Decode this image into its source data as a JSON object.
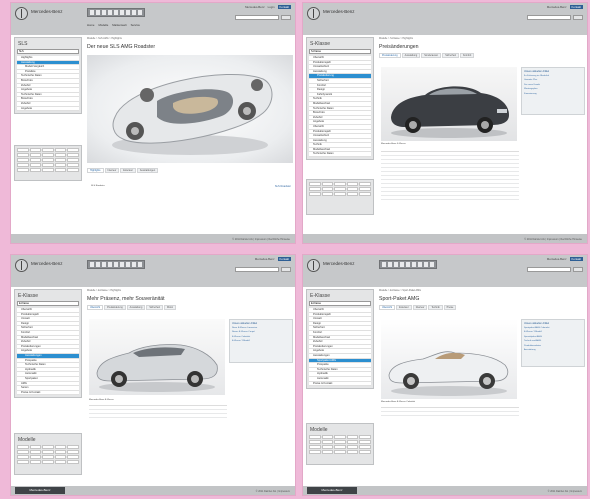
{
  "header": {
    "brand": "Mercedes-Benz",
    "top_links": [
      "Mercedes-Benz",
      "Login",
      "Kontakt"
    ],
    "top_button": "Kontakt",
    "nav": [
      "Home",
      "Modelle",
      "Markenwelt",
      "Service",
      "Über uns",
      "Karriere"
    ]
  },
  "shots": [
    {
      "section_title": "SLS",
      "select_value": "SLS",
      "crumb": "Modelle > SLS AMG > Highlights",
      "title": "Der neue SLS AMG Roadster",
      "menu": [
        "Highlights",
        "Ausstattung",
        "Modell-Vergleich",
        "Preisliste",
        "Technische Daten",
        "Broschüre",
        "Zubehör",
        "Angebote"
      ],
      "active": 1,
      "tabs": [
        "Highlights",
        "Interieur",
        "Exterieur",
        "Ausstattungen"
      ],
      "bottom_left": "SLS Roadster",
      "bottom_right": "SLS Roadster",
      "foot": [
        "© 2011 Daimler AG",
        "Impressum",
        "Rechtliche Hinweise",
        "Cookies"
      ]
    },
    {
      "section_title": "S-Klasse",
      "select_value": "S-Klasse",
      "crumb": "Modelle > S-Klasse > Highlights",
      "title": "Preisänderungen",
      "menu": [
        "Übersicht",
        "Produktionsjahr",
        "Umweltschutz",
        "Ausstattung",
        "Preisänderung",
        "Sicherheit",
        "Komfort",
        "Design",
        "Fahrdynamik",
        "Technik",
        "Modellwechsel",
        "Technische Daten",
        "Broschüre",
        "Zubehör",
        "Angebote"
      ],
      "active": 4,
      "tabs": [
        "Preisänderung",
        "Ausstattung",
        "Sonderausst.",
        "Sicherheit",
        "Komfort"
      ],
      "aside_title": "Unsere aktuellen Artikel",
      "aside_links": [
        "Ihr Fahrzeug im Überblick",
        "Garantie Plus",
        "Der neue Kombi",
        "Wartungsplan",
        "Finanzierung",
        "Versicherung"
      ],
      "caption": "Mercedes-Benz S-Klasse",
      "foot": [
        "© 2011 Daimler AG",
        "Impressum",
        "Rechtliche Hinweise",
        "Cookies"
      ]
    },
    {
      "section_title": "E-Klasse",
      "select_value": "E-Klasse",
      "crumb": "Modelle > E-Klasse > Highlights",
      "title": "Mehr Präsenz, mehr Souveränität",
      "menu": [
        "Übersicht",
        "Produktionsjahr",
        "Umwelt",
        "Design",
        "Sicherheit",
        "Komfort",
        "Modellwechsel",
        "Zubehör",
        "Preisänderungen",
        "Angebote",
        "Ausstattungen",
        "Prospekte",
        "Technische Daten",
        "Hydraulik",
        "Automatik",
        "Sportpaket",
        "AMG",
        "Serien",
        "Preise & Kontakt"
      ],
      "active": 10,
      "tabs": [
        "Übersicht",
        "Preisänderung",
        "Ausstattung",
        "Sicherheit",
        "Motor"
      ],
      "aside_title": "Unsere aktuellen Artikel",
      "aside_links": [
        "Neue E-Klasse Limousine",
        "Neues E-Klasse Coupé",
        "E-Klasse Cabriolet",
        "E-Klasse T-Modell"
      ],
      "caption": "Mercedes-Benz E-Klasse",
      "section2": "Modelle",
      "foot": [
        "© 2011 Daimler AG",
        "Impressum",
        "Rechtliche Hinweise",
        "Cookies"
      ]
    },
    {
      "section_title": "E-Klasse",
      "select_value": "E-Klasse",
      "crumb": "Modelle > E-Klasse > Sport-Paket AMG",
      "title": "Sport-Paket AMG",
      "menu": [
        "Übersicht",
        "Produktionsjahr",
        "Umwelt",
        "Design",
        "Sicherheit",
        "Komfort",
        "Modellwechsel",
        "Zubehör",
        "Preisänderungen",
        "Angebote",
        "Ausstattungen",
        "Sportpaket AMG",
        "Prospekte",
        "Technische Daten",
        "Hydraulik",
        "Automatik",
        "Preise & Kontakt"
      ],
      "active": 11,
      "tabs": [
        "Übersicht",
        "Exterieur",
        "Interieur",
        "Technik",
        "Preise"
      ],
      "aside_title": "Unsere aktuellen Artikel",
      "aside_links": [
        "Sportpaket AMG Cabriolet",
        "E-Klasse T-Modell",
        "Spezialpaket AMG",
        "Technik und AMG",
        "Produktionsdaten",
        "Ausstattung"
      ],
      "caption": "Mercedes-Benz E-Klasse Cabriolet",
      "section2": "Modelle",
      "foot": [
        "© 2011 Daimler AG",
        "Impressum",
        "Rechtliche Hinweise",
        "Cookies"
      ]
    }
  ]
}
